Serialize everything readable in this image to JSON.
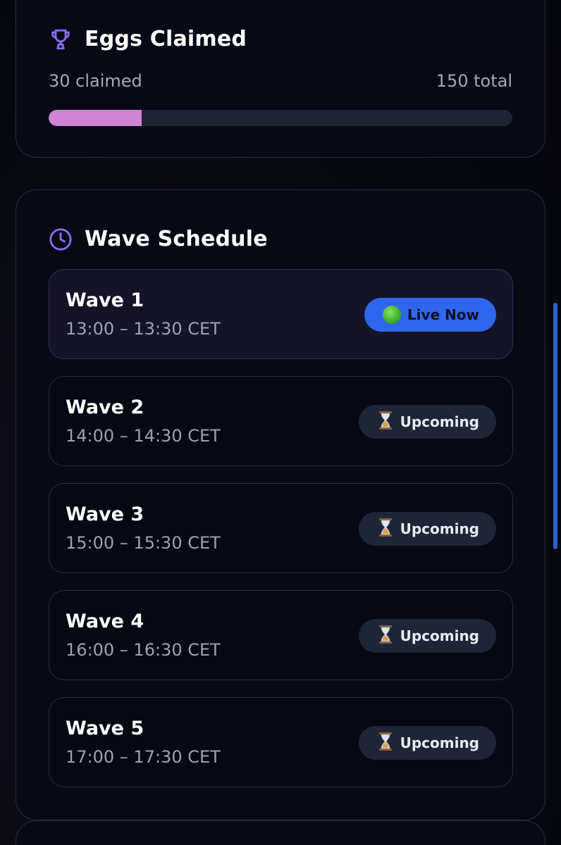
{
  "claimed": {
    "title": "Eggs Claimed",
    "icon": "trophy-icon",
    "claimed_text": "30 claimed",
    "total_text": "150 total",
    "progress": 0.2,
    "progress_color": "#d184d4"
  },
  "schedule": {
    "title": "Wave Schedule",
    "icon": "clock-icon",
    "waves": [
      {
        "name": "Wave 1",
        "time": "13:00 – 13:30 CET",
        "status": "Live Now"
      },
      {
        "name": "Wave 2",
        "time": "14:00 – 14:30 CET",
        "status": "Upcoming"
      },
      {
        "name": "Wave 3",
        "time": "15:00 – 15:30 CET",
        "status": "Upcoming"
      },
      {
        "name": "Wave 4",
        "time": "16:00 – 16:30 CET",
        "status": "Upcoming"
      },
      {
        "name": "Wave 5",
        "time": "17:00 – 17:30 CET",
        "status": "Upcoming"
      }
    ]
  },
  "colors": {
    "accent_purple": "#8b6cf0",
    "live_badge": "#2f66ee",
    "upcoming_badge": "#1e2536"
  }
}
